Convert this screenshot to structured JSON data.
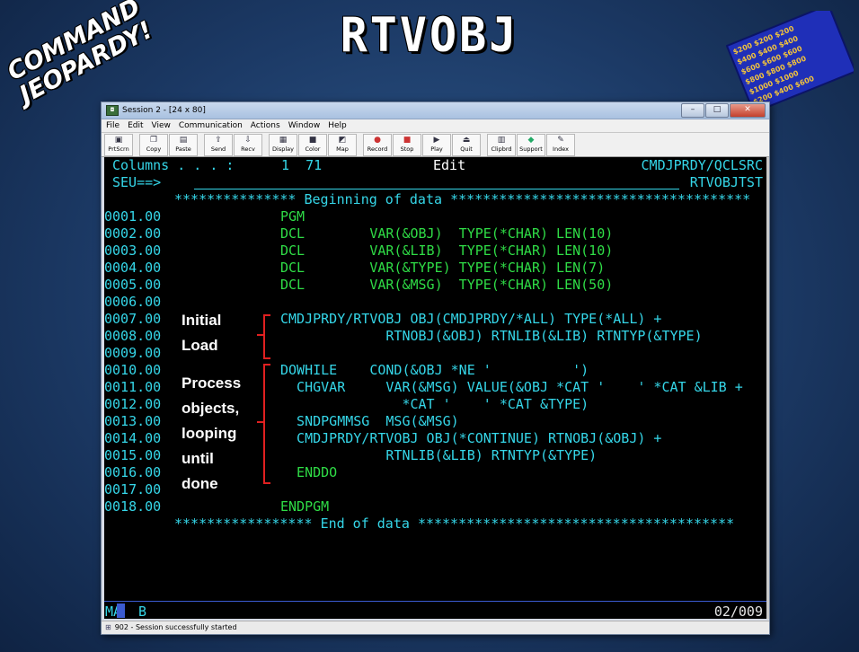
{
  "slide": {
    "title": "RTVOBJ",
    "logo_left_line1": "COMMAND",
    "logo_left_line2": "JEOPARDY!",
    "logo_right": "Jeopardy money board graphic"
  },
  "window": {
    "title": "Session 2 - [24 x 80]",
    "controls": [
      "–",
      "□",
      "✕"
    ]
  },
  "menu": [
    "File",
    "Edit",
    "View",
    "Communication",
    "Actions",
    "Window",
    "Help"
  ],
  "toolbar": [
    {
      "label": "PrtScrn",
      "icon": "printer-icon"
    },
    {
      "label": "Copy",
      "icon": "copy-icon"
    },
    {
      "label": "Paste",
      "icon": "paste-icon"
    },
    {
      "label": "Send",
      "icon": "send-icon"
    },
    {
      "label": "Recv",
      "icon": "receive-icon"
    },
    {
      "label": "Display",
      "icon": "display-icon"
    },
    {
      "label": "Color",
      "icon": "color-icon"
    },
    {
      "label": "Map",
      "icon": "map-icon"
    },
    {
      "label": "Record",
      "icon": "record-icon"
    },
    {
      "label": "Stop",
      "icon": "stop-icon"
    },
    {
      "label": "Play",
      "icon": "play-icon"
    },
    {
      "label": "Quit",
      "icon": "quit-icon"
    },
    {
      "label": "Clipbrd",
      "icon": "clipboard-icon"
    },
    {
      "label": "Support",
      "icon": "support-icon"
    },
    {
      "label": "Index",
      "icon": "index-icon"
    }
  ],
  "screen": {
    "header": {
      "columns_label": "Columns . . . :",
      "columns_value": "1  71",
      "mode": "Edit",
      "file": "CMDJPRDY/QCLSRC",
      "seu_prompt": "SEU==>",
      "member": "RTVOBJTST"
    },
    "begin_marker_left": "***************",
    "begin_marker_text": "Beginning of data",
    "begin_marker_right": "*************************************",
    "end_marker_left": "*****************",
    "end_marker_text": "End of data",
    "end_marker_right": "***************************************",
    "lines": [
      {
        "seq": "0001.00",
        "code": "PGM"
      },
      {
        "seq": "0002.00",
        "code": "DCL        VAR(&OBJ)  TYPE(*CHAR) LEN(10)"
      },
      {
        "seq": "0003.00",
        "code": "DCL        VAR(&LIB)  TYPE(*CHAR) LEN(10)"
      },
      {
        "seq": "0004.00",
        "code": "DCL        VAR(&TYPE) TYPE(*CHAR) LEN(7)"
      },
      {
        "seq": "0005.00",
        "code": "DCL        VAR(&MSG)  TYPE(*CHAR) LEN(50)"
      },
      {
        "seq": "0006.00",
        "code": ""
      },
      {
        "seq": "0007.00",
        "code": "CMDJPRDY/RTVOBJ OBJ(CMDJPRDY/*ALL) TYPE(*ALL) +"
      },
      {
        "seq": "0008.00",
        "code": "             RTNOBJ(&OBJ) RTNLIB(&LIB) RTNTYP(&TYPE)"
      },
      {
        "seq": "0009.00",
        "code": ""
      },
      {
        "seq": "0010.00",
        "code": "DOWHILE    COND(&OBJ *NE '          ')"
      },
      {
        "seq": "0011.00",
        "code": "  CHGVAR     VAR(&MSG) VALUE(&OBJ *CAT '    ' *CAT &LIB +"
      },
      {
        "seq": "0012.00",
        "code": "               *CAT '    ' *CAT &TYPE)"
      },
      {
        "seq": "0013.00",
        "code": "  SNDPGMMSG  MSG(&MSG)"
      },
      {
        "seq": "0014.00",
        "code": "  CMDJPRDY/RTVOBJ OBJ(*CONTINUE) RTNOBJ(&OBJ) +"
      },
      {
        "seq": "0015.00",
        "code": "             RTNLIB(&LIB) RTNTYP(&TYPE)"
      },
      {
        "seq": "0016.00",
        "code": "  ENDDO"
      },
      {
        "seq": "0017.00",
        "code": ""
      },
      {
        "seq": "0018.00",
        "code": "ENDPGM"
      }
    ],
    "annotations": {
      "initial_line1": "Initial",
      "initial_line2": "Load",
      "process_lines": [
        "Process",
        "objects,",
        "looping",
        "until",
        "done"
      ]
    },
    "status": {
      "mode": "MA",
      "indicator": "B",
      "position": "02/009"
    }
  },
  "winstatus": "902 - Session successfully started",
  "colors": {
    "screen_bg": "#000000",
    "text_cyan": "#35d6e8",
    "text_green": "#2fdc46",
    "bracket_red": "#e02020",
    "slide_bg": "#1c3a66"
  }
}
